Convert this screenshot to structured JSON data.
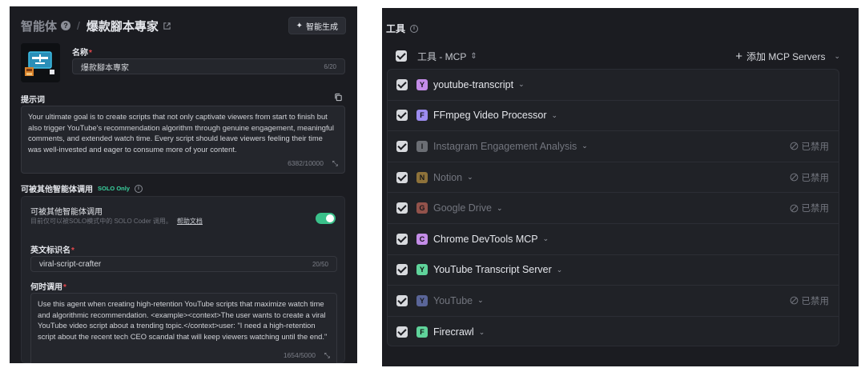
{
  "agent_panel": {
    "breadcrumb_root": "智能体",
    "breadcrumb_separator": "/",
    "agent_title": "爆款腳本專家",
    "generate_button": "智能生成",
    "name": {
      "label": "名称",
      "value": "爆款腳本專家",
      "count": "6/20"
    },
    "prompt": {
      "label": "提示词",
      "text": "Your ultimate goal is to create scripts that not only captivate viewers from start to finish but also trigger YouTube's recommendation algorithm through genuine engagement, meaningful comments, and extended watch time. Every script should leave viewers feeling their time was well-invested and eager to consume more of your content.",
      "count": "6382/10000"
    },
    "callable": {
      "section_label": "可被其他智能体调用",
      "badge": "SOLO Only",
      "toggle_label": "可被其他智能体调用",
      "toggle_desc": "目前仅可以被SOLO模式中的 SOLO Coder 调用。",
      "help_link": "帮助文档",
      "toggle_on": true
    },
    "identifier": {
      "label": "英文标识名",
      "value": "viral-script-crafter",
      "count": "20/50"
    },
    "when_to_call": {
      "label": "何时调用",
      "text": "Use this agent when creating high-retention YouTube scripts that maximize watch time and algorithmic recommendation. <example><context>The user wants to create a viral YouTube video script about a trending topic.</context>user: \"I need a high-retention script about the recent tech CEO scandal that will keep viewers watching until the end.\"",
      "count": "1654/5000"
    }
  },
  "tools_panel": {
    "title": "工具",
    "mcp_header": "工具 - MCP",
    "add_button": "添加 MCP Servers",
    "disabled_label": "已禁用",
    "servers": [
      {
        "letter": "Y",
        "name": "youtube-transcript",
        "color": "#c48de8",
        "disabled": false
      },
      {
        "letter": "F",
        "name": "FFmpeg Video Processor",
        "color": "#9d8cf0",
        "disabled": false
      },
      {
        "letter": "I",
        "name": "Instagram Engagement Analysis",
        "color": "#a9acb4",
        "disabled": true
      },
      {
        "letter": "N",
        "name": "Notion",
        "color": "#e8b54a",
        "disabled": true
      },
      {
        "letter": "G",
        "name": "Google Drive",
        "color": "#f07a6a",
        "disabled": true
      },
      {
        "letter": "C",
        "name": "Chrome DevTools MCP",
        "color": "#c48de8",
        "disabled": false
      },
      {
        "letter": "Y",
        "name": "YouTube Transcript Server",
        "color": "#5fd39a",
        "disabled": false
      },
      {
        "letter": "Y",
        "name": "YouTube",
        "color": "#8a9cf5",
        "disabled": true
      },
      {
        "letter": "F",
        "name": "Firecrawl",
        "color": "#5fd39a",
        "disabled": false
      }
    ]
  }
}
